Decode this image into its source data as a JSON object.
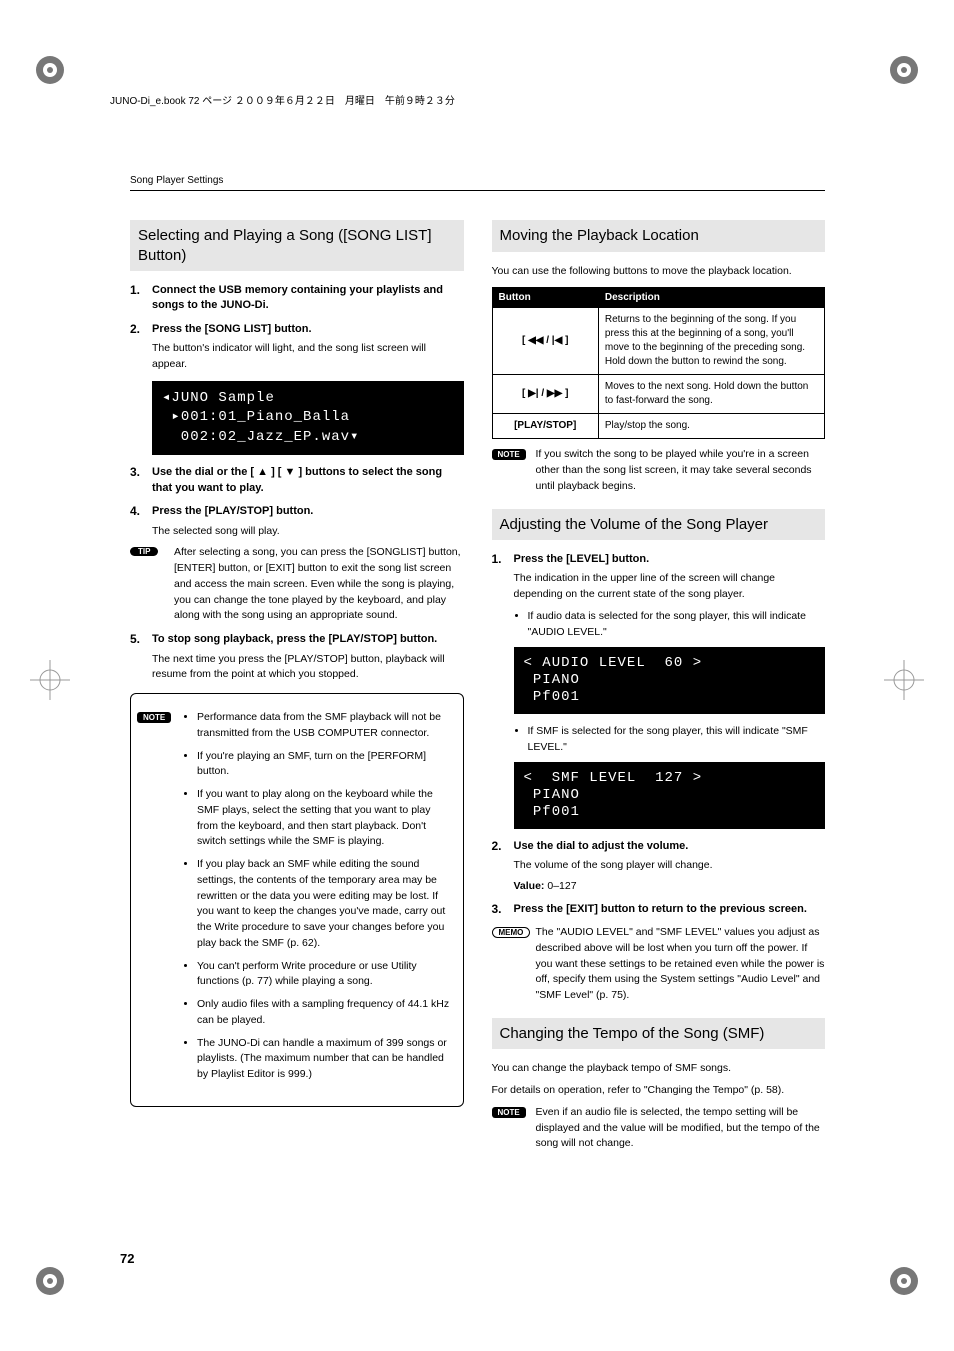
{
  "header": {
    "book_line": "JUNO-Di_e.book  72 ページ  ２００９年６月２２日　月曜日　午前９時２３分",
    "running_head": "Song Player Settings"
  },
  "left": {
    "section_title": "Selecting and Playing a Song ([SONG LIST] Button)",
    "steps": [
      {
        "num": "1.",
        "label": "Connect the USB memory containing your playlists and songs to the JUNO-Di."
      },
      {
        "num": "2.",
        "label": "Press the [SONG LIST] button.",
        "sub": "The button's indicator will light, and the song list screen will appear."
      },
      {
        "num": "3.",
        "label": "Use the dial or the [ ▲ ] [ ▼ ] buttons to select the song that you want to play."
      },
      {
        "num": "4.",
        "label": "Press the [PLAY/STOP] button.",
        "sub": "The selected song will play."
      },
      {
        "num": "5.",
        "label": "To stop song playback, press the [PLAY/STOP] button.",
        "sub": "The next time you press the [PLAY/STOP] button, playback will resume from the point at which you stopped."
      }
    ],
    "lcd": "◂JUNO Sample\n ▸001:01_Piano_Balla\n  002:02_Jazz_EP.wav▾",
    "tip": "After selecting a song, you can press the [SONGLIST] button, [ENTER] button, or [EXIT] button to exit the song list screen and access the main screen. Even while the song is playing, you can change the tone played by the keyboard, and play along with the song using an appropriate sound.",
    "note_label": "NOTE",
    "tip_label": "TIP",
    "note_bullets": [
      "Performance data from the SMF playback will not be transmitted from the USB COMPUTER connector.",
      "If you're playing an SMF, turn on the [PERFORM] button.",
      "If you want to play along on the keyboard while the SMF plays, select the setting that you want to play from the keyboard, and then start playback. Don't switch settings while the SMF is playing.",
      "If you play back an SMF while editing the sound settings, the contents of the temporary area may be rewritten or the data you were editing may be lost. If you want to keep the changes you've made, carry out the Write procedure to save your changes before you play back the SMF (p. 62).",
      "You can't perform Write procedure or use Utility functions (p. 77) while playing a song.",
      "Only audio files with a sampling frequency of 44.1 kHz can be played.",
      "The JUNO-Di can handle a maximum of 399 songs or playlists. (The maximum number that can be handled by Playlist Editor is 999.)"
    ]
  },
  "right": {
    "sec1_title": "Moving the Playback Location",
    "sec1_intro": "You can use the following buttons to move the playback location.",
    "table": {
      "headers": [
        "Button",
        "Description"
      ],
      "rows": [
        {
          "btn": "[ ◀◀ / |◀ ]",
          "desc": "Returns to the beginning of the song. If you press this at the beginning of a song, you'll move to the beginning of the preceding song. Hold down the button to rewind the song."
        },
        {
          "btn": "[ ▶| / ▶▶ ]",
          "desc": "Moves to the next song. Hold down the button to fast-forward the song."
        },
        {
          "btn": "[PLAY/STOP]",
          "desc": "Play/stop the song."
        }
      ]
    },
    "sec1_note": "If you switch the song to be played while you're in a screen other than the song list screen, it may take several seconds until playback begins.",
    "sec2_title": "Adjusting the Volume of the Song Player",
    "sec2_step1": {
      "num": "1.",
      "label": "Press the [LEVEL] button.",
      "sub": "The indication in the upper line of the screen will change depending on the current state of the song player."
    },
    "sec2_bullet1": "If audio data is selected for the song player, this will indicate \"AUDIO LEVEL.\"",
    "sec2_lcd1": "< AUDIO LEVEL  60 >\n PIANO\n Pf001",
    "sec2_bullet2": "If SMF is selected for the song player, this will indicate \"SMF LEVEL.\"",
    "sec2_lcd2": "<  SMF LEVEL  127 >\n PIANO\n Pf001",
    "sec2_step2": {
      "num": "2.",
      "label": "Use the dial to adjust the volume.",
      "sub": "The volume of the song player will change."
    },
    "sec2_value_label": "Value:",
    "sec2_value": "0–127",
    "sec2_step3": {
      "num": "3.",
      "label": "Press the [EXIT] button to return to the previous screen."
    },
    "memo_label": "MEMO",
    "sec2_memo": "The \"AUDIO LEVEL\" and \"SMF LEVEL\" values you adjust as described above will be lost when you turn off the power. If you want these settings to be retained even while the power is off, specify them using the System settings \"Audio Level\" and \"SMF Level\" (p. 75).",
    "sec3_title": "Changing the Tempo of the Song (SMF)",
    "sec3_line1": "You can change the playback tempo of SMF songs.",
    "sec3_line2": "For details on operation, refer to  \"Changing the Tempo\" (p. 58).",
    "sec3_note": "Even if an audio file is selected, the tempo setting will be displayed and the value will be modified, but the tempo of the song will not change."
  },
  "page_number": "72"
}
